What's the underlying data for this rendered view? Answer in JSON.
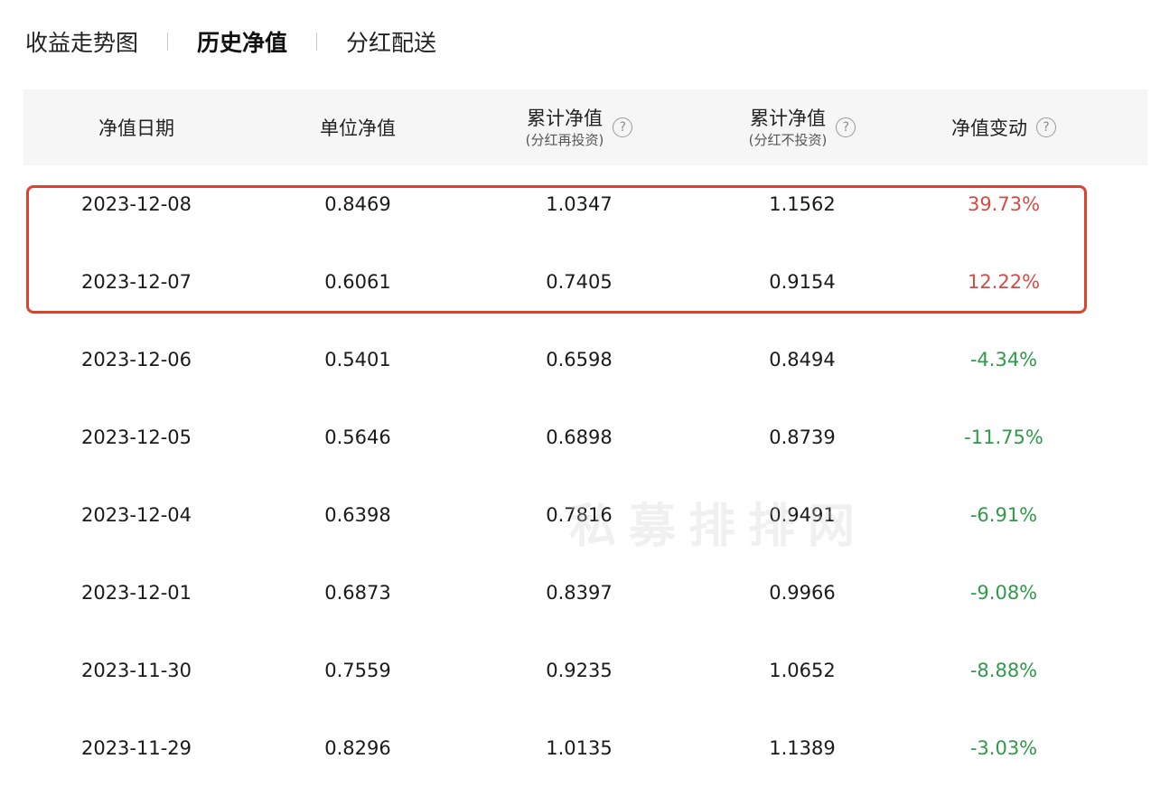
{
  "tabs": [
    {
      "label": "收益走势图",
      "active": false
    },
    {
      "label": "历史净值",
      "active": true
    },
    {
      "label": "分红配送",
      "active": false
    }
  ],
  "table": {
    "headers": {
      "date": "净值日期",
      "unit_nav": "单位净值",
      "acc_nav_reinvest": "累计净值",
      "acc_nav_reinvest_sub": "(分红再投资)",
      "acc_nav_no_reinvest": "累计净值",
      "acc_nav_no_reinvest_sub": "(分红不投资)",
      "change": "净值变动"
    },
    "help_glyph": "?",
    "rows": [
      {
        "date": "2023-12-08",
        "unit": "0.8469",
        "acc_re": "1.0347",
        "acc_no": "1.1562",
        "change": "39.73%",
        "trend": "up"
      },
      {
        "date": "2023-12-07",
        "unit": "0.6061",
        "acc_re": "0.7405",
        "acc_no": "0.9154",
        "change": "12.22%",
        "trend": "up"
      },
      {
        "date": "2023-12-06",
        "unit": "0.5401",
        "acc_re": "0.6598",
        "acc_no": "0.8494",
        "change": "-4.34%",
        "trend": "down"
      },
      {
        "date": "2023-12-05",
        "unit": "0.5646",
        "acc_re": "0.6898",
        "acc_no": "0.8739",
        "change": "-11.75%",
        "trend": "down"
      },
      {
        "date": "2023-12-04",
        "unit": "0.6398",
        "acc_re": "0.7816",
        "acc_no": "0.9491",
        "change": "-6.91%",
        "trend": "down"
      },
      {
        "date": "2023-12-01",
        "unit": "0.6873",
        "acc_re": "0.8397",
        "acc_no": "0.9966",
        "change": "-9.08%",
        "trend": "down"
      },
      {
        "date": "2023-11-30",
        "unit": "0.7559",
        "acc_re": "0.9235",
        "acc_no": "1.0652",
        "change": "-8.88%",
        "trend": "down"
      },
      {
        "date": "2023-11-29",
        "unit": "0.8296",
        "acc_re": "1.0135",
        "acc_no": "1.1389",
        "change": "-3.03%",
        "trend": "down"
      }
    ]
  },
  "watermark": "私募排排网",
  "colors": {
    "positive": "#d84a45",
    "negative": "#2f9a4a",
    "highlight_border": "#d8442f",
    "header_bg": "#f6f6f6"
  }
}
